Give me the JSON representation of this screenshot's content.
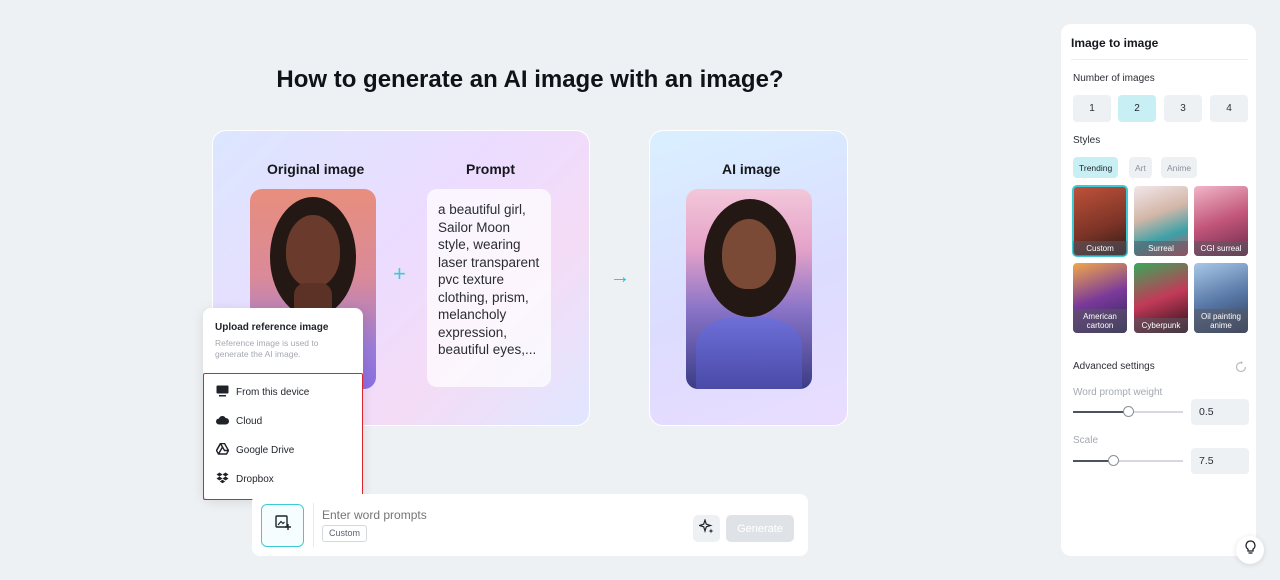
{
  "page": {
    "title": "How to generate an AI image with an image?"
  },
  "demo": {
    "original_label": "Original image",
    "prompt_label": "Prompt",
    "ai_label": "AI image",
    "prompt_text": "a beautiful girl, Sailor Moon style, wearing laser transparent pvc texture clothing, prism, melancholy expression, beautiful eyes,..."
  },
  "upload_popup": {
    "title": "Upload reference image",
    "subtitle": "Reference image is used to generate the AI image.",
    "items": [
      {
        "label": "From this device",
        "icon": "monitor-icon"
      },
      {
        "label": "Cloud",
        "icon": "cloud-icon"
      },
      {
        "label": "Google Drive",
        "icon": "google-drive-icon"
      },
      {
        "label": "Dropbox",
        "icon": "dropbox-icon"
      }
    ]
  },
  "input_bar": {
    "placeholder": "Enter word prompts",
    "style_chip": "Custom",
    "generate_label": "Generate"
  },
  "panel": {
    "title": "Image to image",
    "number_label": "Number of images",
    "numbers": [
      "1",
      "2",
      "3",
      "4"
    ],
    "selected_number": "2",
    "styles_label": "Styles",
    "style_tabs": [
      "Trending",
      "Art",
      "Anime"
    ],
    "active_style_tab": "Trending",
    "style_thumbs": [
      {
        "label": "Custom"
      },
      {
        "label": "Surreal"
      },
      {
        "label": "CGI surreal"
      },
      {
        "label": "American cartoon"
      },
      {
        "label": "Cyberpunk"
      },
      {
        "label": "Oil painting anime"
      }
    ],
    "selected_style": "Custom",
    "advanced_label": "Advanced settings",
    "word_weight_label": "Word prompt weight",
    "word_weight_value": "0.5",
    "scale_label": "Scale",
    "scale_value": "7.5"
  },
  "colors": {
    "accent": "#3ccbd6",
    "highlight_border": "#d9262c",
    "background": "#eef1f4"
  }
}
